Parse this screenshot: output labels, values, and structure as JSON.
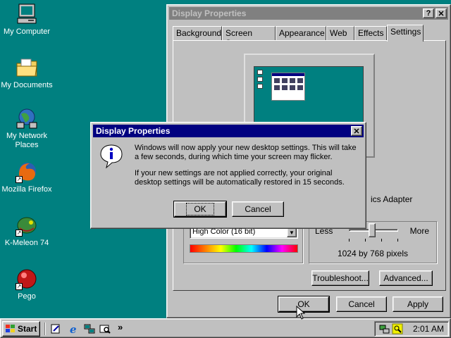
{
  "desktop": {
    "icons": [
      {
        "label": "My Computer",
        "icon": "my-computer-icon"
      },
      {
        "label": "My Documents",
        "icon": "folder-documents-icon"
      },
      {
        "label": "My Network Places",
        "icon": "network-places-icon"
      },
      {
        "label": "Mozilla Firefox",
        "icon": "firefox-icon"
      },
      {
        "label": "K-Meleon 74",
        "icon": "k-meleon-icon"
      },
      {
        "label": "Pego",
        "icon": "pego-icon"
      }
    ]
  },
  "display_properties": {
    "title": "Display Properties",
    "help_glyph": "?",
    "close_glyph": "✕",
    "tabs": [
      "Background",
      "Screen Saver",
      "Appearance",
      "Web",
      "Effects",
      "Settings"
    ],
    "active_tab": "Settings",
    "adapter_label_partial": "ics Adapter",
    "colors_value": "High Color (16 bit)",
    "screen_area": {
      "less": "Less",
      "more": "More",
      "value": "1024 by 768 pixels"
    },
    "buttons": {
      "troubleshoot": "Troubleshoot...",
      "advanced": "Advanced...",
      "ok": "OK",
      "cancel": "Cancel",
      "apply": "Apply"
    }
  },
  "message_dialog": {
    "title": "Display Properties",
    "close_glyph": "✕",
    "line1": "Windows will now apply your new desktop settings. This will take a few seconds, during which time your screen may flicker.",
    "line2": "If your new settings are not applied correctly, your original desktop settings will be automatically restored in 15 seconds.",
    "ok": "OK",
    "cancel": "Cancel",
    "icon": "info-icon"
  },
  "taskbar": {
    "start_label": "Start",
    "chevron": "»",
    "clock": "2:01 AM"
  },
  "colors": {
    "desktop": "#008080",
    "active_title": "#000080",
    "inactive_title": "#808080",
    "face": "#c0c0c0"
  }
}
